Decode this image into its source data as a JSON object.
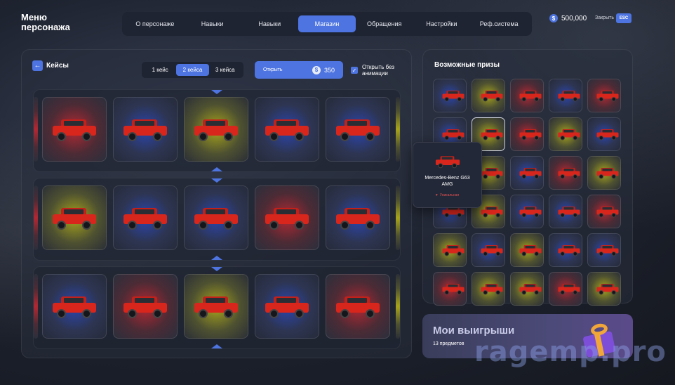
{
  "header": {
    "title": "Меню персонажа",
    "tabs": [
      "О персонаже",
      "Навыки",
      "Навыки",
      "Магазин",
      "Обращения",
      "Настройки",
      "Реф.система"
    ],
    "active_tab": 3,
    "balance": "500,000",
    "close_label": "Закрыть",
    "esc_label": "ESC"
  },
  "cases": {
    "back_icon": "arrow-left-icon",
    "title": "Кейсы",
    "count_options": [
      "1 кейс",
      "2 кейса",
      "3 кейса"
    ],
    "active_count": 1,
    "open_label": "Открыть",
    "price": "350",
    "no_anim_label": "Открыть без анимации",
    "rows": [
      [
        "red",
        "blue",
        "yellow",
        "blue",
        "blue"
      ],
      [
        "yellow",
        "blue",
        "blue",
        "red",
        "blue"
      ],
      [
        "blue",
        "red",
        "yellow",
        "blue",
        "red"
      ]
    ]
  },
  "prizes": {
    "title": "Возможные призы",
    "grid": [
      "blue",
      "yellow",
      "red",
      "blue",
      "red",
      "blue",
      "yellow",
      "red",
      "yellow",
      "blue",
      "blue",
      "yellow",
      "blue",
      "red",
      "yellow",
      "blue",
      "yellow",
      "blue",
      "blue",
      "red",
      "yellow",
      "blue",
      "yellow",
      "blue",
      "blue",
      "red",
      "yellow",
      "yellow",
      "red",
      "yellow"
    ],
    "tooltip": {
      "name": "Mercedes-Benz G63 AMG",
      "rarity": "Уникальная"
    }
  },
  "wins": {
    "title": "Мои выигрыши",
    "count": "13 предметов"
  },
  "watermark": "ragemp.pro",
  "colors": {
    "accent": "#4d74e0"
  }
}
